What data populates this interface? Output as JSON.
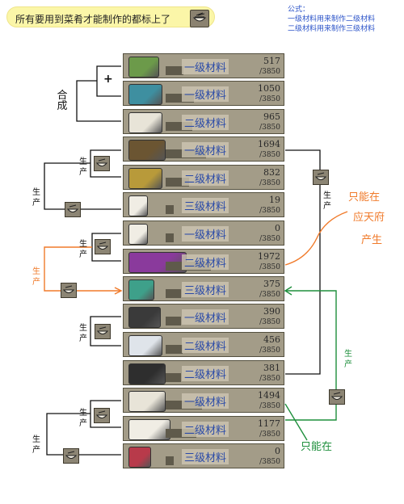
{
  "note": {
    "text": "所有要用到菜肴才能制作的都标上了"
  },
  "formula": {
    "title": "公式：",
    "line1": "一级材料用来制作二级材料",
    "line2": "二级材料用来制作三级材料"
  },
  "rows": [
    {
      "name": "一级材料",
      "count": "517",
      "max": "/3850"
    },
    {
      "name": "一级材料",
      "count": "1050",
      "max": "/3850"
    },
    {
      "name": "二级材料",
      "count": "965",
      "max": "/3850"
    },
    {
      "name": "一级材料",
      "count": "1694",
      "max": "/3850"
    },
    {
      "name": "二级材料",
      "count": "832",
      "max": "/3850"
    },
    {
      "name": "三级材料",
      "count": "19",
      "max": "/3850"
    },
    {
      "name": "一级材料",
      "count": "0",
      "max": "/3850"
    },
    {
      "name": "二级材料",
      "count": "1972",
      "max": "/3850"
    },
    {
      "name": "三级材料",
      "count": "375",
      "max": "/3850"
    },
    {
      "name": "一级材料",
      "count": "390",
      "max": "/3850"
    },
    {
      "name": "二级材料",
      "count": "456",
      "max": "/3850"
    },
    {
      "name": "二级材料",
      "count": "381",
      "max": "/3850"
    },
    {
      "name": "一级材料",
      "count": "1494",
      "max": "/3850"
    },
    {
      "name": "二级材料",
      "count": "1177",
      "max": "/3850"
    },
    {
      "name": "三级材料",
      "count": "0",
      "max": "/3850"
    }
  ],
  "labels": {
    "plus": "+",
    "combine": "合成",
    "produce": "生产",
    "produce_orange": "生产",
    "produce_green": "生产",
    "only_at_orange": "只能在",
    "yingtian": "应天府",
    "chansheng": "产生",
    "only_at_green": "只能在"
  },
  "colors": {
    "orange": "#f07a2a",
    "green": "#1e8f3c",
    "blue": "#2a4aa8",
    "panel": "#a39c88"
  }
}
